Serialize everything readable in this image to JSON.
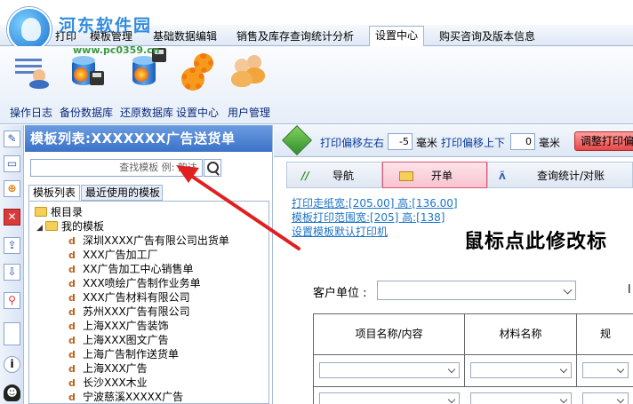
{
  "watermark": {
    "text": "河东软件园",
    "url": "www.pc0359.cn"
  },
  "menu": {
    "tabs": [
      "打印",
      "模板管理",
      "基础数据编辑",
      "销售及库存查询统计分析",
      "设置中心",
      "购买咨询及版本信息"
    ],
    "active": "设置中心"
  },
  "ribbon": {
    "buttons": [
      {
        "label": "操作日志",
        "icon": "log-icon"
      },
      {
        "label": "备份数据库",
        "icon": "backup-database-icon"
      },
      {
        "label": "还原数据库",
        "icon": "restore-database-icon"
      },
      {
        "label": "设置中心",
        "icon": "gears-icon"
      },
      {
        "label": "用户管理",
        "icon": "users-icon"
      }
    ]
  },
  "left_toolbar": {
    "icons": [
      "edit-icon",
      "monitor-icon",
      "add-icon",
      "delete-icon",
      "export-icon",
      "import-icon",
      "pin-icon",
      "page-icon",
      "info-icon",
      "qq-icon"
    ]
  },
  "template_panel": {
    "title": "模板列表:XXXXXXX广告送货单",
    "search_placeholder": "查找模板 例: 韵达",
    "tabs": [
      "模板列表",
      "最近使用的模板"
    ],
    "root": "根目录",
    "my_templates": "我的模板",
    "items": [
      "深圳XXXX广告有限公司出货单",
      "XXX广告加工厂",
      "XX广告加工中心销售单",
      "XXX喷绘广告制作业务单",
      "XXX广告材料有限公司",
      "苏州XXX广告有限公司",
      "上海XXX广告装饰",
      "上海XXX图文广告",
      "上海广告制作送货单",
      "上海XXX广告",
      "长沙XXX木业",
      "宁波慈溪XXXXX广告"
    ]
  },
  "print_toolbar": {
    "offset_lr_label": "打印偏移左右",
    "offset_lr_value": "-5",
    "unit1": "毫米",
    "offset_ud_label": "打印偏移上下",
    "offset_ud_value": "0",
    "unit2": "毫米",
    "adjust_button": "调整打印偏"
  },
  "sub_tabs": [
    "导航",
    "开单",
    "查询统计/对账"
  ],
  "active_sub_tab": "开单",
  "links": {
    "paper": "打印走纸宽:[205.00] 高:[136.00]",
    "range": "模板打印范围宽:[205] 高:[138]",
    "default_printer": "设置模板默认打印机"
  },
  "form": {
    "title": "鼠标点此修改标",
    "customer_label": "客户单位 :",
    "edge_char": "l",
    "columns": [
      "项目名称/内容",
      "材料名称",
      "规"
    ]
  }
}
